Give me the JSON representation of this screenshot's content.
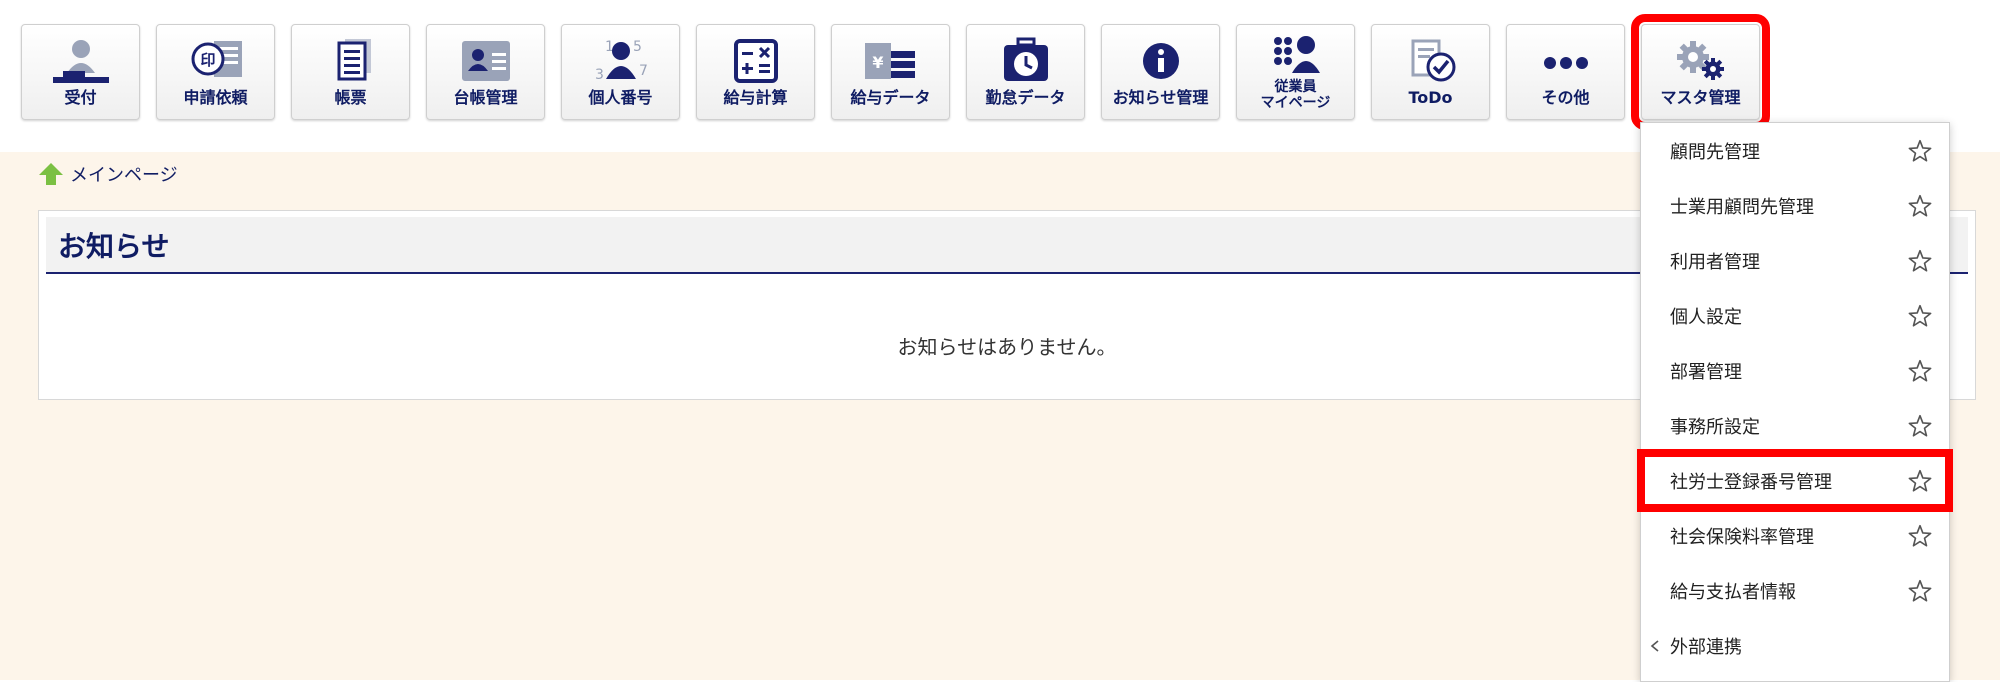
{
  "toolbar": {
    "buttons": [
      {
        "label": "受付",
        "icon": "reception-icon"
      },
      {
        "label": "申請依頼",
        "icon": "seal-request-icon"
      },
      {
        "label": "帳票",
        "icon": "forms-icon"
      },
      {
        "label": "台帳管理",
        "icon": "ledger-icon"
      },
      {
        "label": "個人番号",
        "icon": "personal-number-icon"
      },
      {
        "label": "給与計算",
        "icon": "calculator-icon"
      },
      {
        "label": "給与データ",
        "icon": "payroll-data-icon"
      },
      {
        "label": "勤怠データ",
        "icon": "attendance-clock-icon"
      },
      {
        "label": "お知らせ管理",
        "icon": "info-icon"
      },
      {
        "label_line1": "従業員",
        "label_line2": "マイページ",
        "icon": "employee-mypage-icon"
      },
      {
        "label": "ToDo",
        "icon": "todo-check-icon"
      },
      {
        "label": "その他",
        "icon": "more-dots-icon"
      },
      {
        "label": "マスタ管理",
        "icon": "gears-icon"
      }
    ]
  },
  "breadcrumb": {
    "label": "メインページ",
    "icon": "home-arrow-icon"
  },
  "panel": {
    "title": "お知らせ",
    "empty_message": "お知らせはありません。"
  },
  "dropdown": {
    "items": [
      {
        "label": "顧問先管理"
      },
      {
        "label": "士業用顧問先管理"
      },
      {
        "label": "利用者管理"
      },
      {
        "label": "個人設定"
      },
      {
        "label": "部署管理"
      },
      {
        "label": "事務所設定"
      },
      {
        "label": "社労士登録番号管理"
      },
      {
        "label": "社会保険料率管理"
      },
      {
        "label": "給与支払者情報"
      }
    ],
    "submenu": {
      "label": "外部連携"
    }
  },
  "colors": {
    "navy": "#0f1c63",
    "highlight": "#ff0000",
    "background": "#fdf5ea",
    "home_green": "#7bc043"
  }
}
